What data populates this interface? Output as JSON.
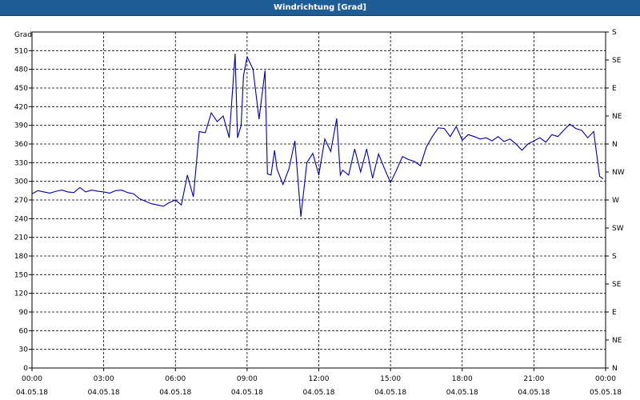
{
  "window": {
    "title": "Windrichtung [Grad]"
  },
  "chart_data": {
    "type": "line",
    "title": "Windrichtung [Grad]",
    "ylabel": "Grad",
    "ylim": [
      0,
      540
    ],
    "y_ticks": [
      0,
      30,
      60,
      90,
      120,
      150,
      180,
      210,
      240,
      270,
      300,
      330,
      360,
      390,
      420,
      450,
      480,
      510
    ],
    "right_ticks": [
      "N",
      "NE",
      "E",
      "SE",
      "S",
      "SW",
      "W",
      "NW",
      "N",
      "NE",
      "E",
      "SE",
      "S"
    ],
    "x_ticks": [
      {
        "time": "00:00",
        "date": "04.05.18"
      },
      {
        "time": "03:00",
        "date": "04.05.18"
      },
      {
        "time": "06:00",
        "date": "04.05.18"
      },
      {
        "time": "09:00",
        "date": "04.05.18"
      },
      {
        "time": "12:00",
        "date": "04.05.18"
      },
      {
        "time": "15:00",
        "date": "04.05.18"
      },
      {
        "time": "18:00",
        "date": "04.05.18"
      },
      {
        "time": "21:00",
        "date": "04.05.18"
      },
      {
        "time": "00:00",
        "date": "05.05.18"
      }
    ],
    "xlim_hours": [
      0,
      24
    ],
    "grid": true,
    "line_color": "#0000a0",
    "series": [
      {
        "x": [
          0,
          0.25,
          0.5,
          0.75,
          1.0,
          1.25,
          1.5,
          1.75,
          2.0,
          2.25,
          2.5,
          2.75,
          3.0,
          3.25,
          3.5,
          3.75,
          4.0,
          4.25,
          4.5,
          4.75,
          5.0,
          5.25,
          5.5,
          5.75,
          6.0,
          6.25,
          6.5,
          6.75,
          7.0,
          7.25,
          7.5,
          7.75,
          8.0,
          8.25,
          8.5,
          8.6,
          8.75,
          8.85,
          9.0,
          9.25,
          9.5,
          9.75,
          9.85,
          10.0,
          10.15,
          10.25,
          10.5,
          10.75,
          11.0,
          11.25,
          11.5,
          11.75,
          12.0,
          12.25,
          12.5,
          12.75,
          12.9,
          13.0,
          13.25,
          13.5,
          13.75,
          14.0,
          14.25,
          14.5,
          14.75,
          15.0,
          15.25,
          15.5,
          15.75,
          16.0,
          16.25,
          16.5,
          16.75,
          17.0,
          17.25,
          17.5,
          17.75,
          18.0,
          18.25,
          18.5,
          18.75,
          19.0,
          19.25,
          19.5,
          19.75,
          20.0,
          20.25,
          20.5,
          20.75,
          21.0,
          21.25,
          21.5,
          21.75,
          22.0,
          22.25,
          22.5,
          22.75,
          23.0,
          23.25,
          23.5,
          23.75,
          23.9
        ],
        "y": [
          280,
          285,
          283,
          281,
          284,
          286,
          283,
          282,
          290,
          283,
          286,
          284,
          283,
          281,
          285,
          286,
          282,
          280,
          272,
          268,
          264,
          262,
          260,
          266,
          270,
          262,
          310,
          275,
          380,
          378,
          410,
          396,
          405,
          370,
          505,
          370,
          390,
          470,
          500,
          480,
          400,
          478,
          312,
          310,
          350,
          320,
          295,
          320,
          365,
          243,
          330,
          345,
          310,
          368,
          348,
          401,
          310,
          318,
          310,
          352,
          315,
          352,
          305,
          344,
          320,
          298,
          318,
          340,
          335,
          332,
          325,
          355,
          372,
          386,
          385,
          372,
          388,
          366,
          375,
          372,
          368,
          370,
          365,
          372,
          364,
          368,
          360,
          350,
          360,
          365,
          370,
          363,
          375,
          372,
          382,
          392,
          385,
          382,
          370,
          380,
          308,
          304
        ]
      }
    ]
  }
}
